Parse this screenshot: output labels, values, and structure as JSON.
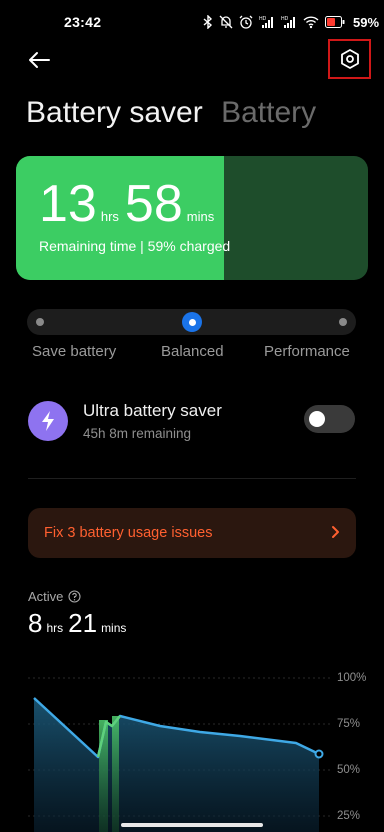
{
  "status_bar": {
    "time": "23:42",
    "battery_percent": "59%",
    "icons": [
      "bluetooth-icon",
      "mute-icon",
      "alarm-icon",
      "hd-signal-icon",
      "hd-signal-icon",
      "wifi-icon",
      "battery-icon"
    ]
  },
  "header": {
    "title_active": "Battery saver",
    "title_inactive": "Battery"
  },
  "battery_card": {
    "hours": "13",
    "hours_unit": "hrs",
    "minutes": "58",
    "minutes_unit": "mins",
    "subtitle": "Remaining time | 59% charged",
    "charge_fraction": 0.59,
    "colors": {
      "charged": "#3ccd63",
      "remaining": "#1e4d2b"
    }
  },
  "modes": {
    "items": [
      "Save battery",
      "Balanced",
      "Performance"
    ],
    "selected": "Balanced",
    "accent": "#1a73e8"
  },
  "ultra_saver": {
    "title": "Ultra battery saver",
    "subtitle": "45h 8m remaining",
    "enabled": false,
    "icon": "lightning-icon"
  },
  "issues_banner": {
    "text": "Fix 3 battery usage issues",
    "color": "#ff6030"
  },
  "active": {
    "label": "Active",
    "hours": "8",
    "hours_unit": "hrs",
    "minutes": "21",
    "minutes_unit": "mins"
  },
  "graph": {
    "y_ticks": [
      "100%",
      "75%",
      "50%",
      "25%"
    ]
  }
}
